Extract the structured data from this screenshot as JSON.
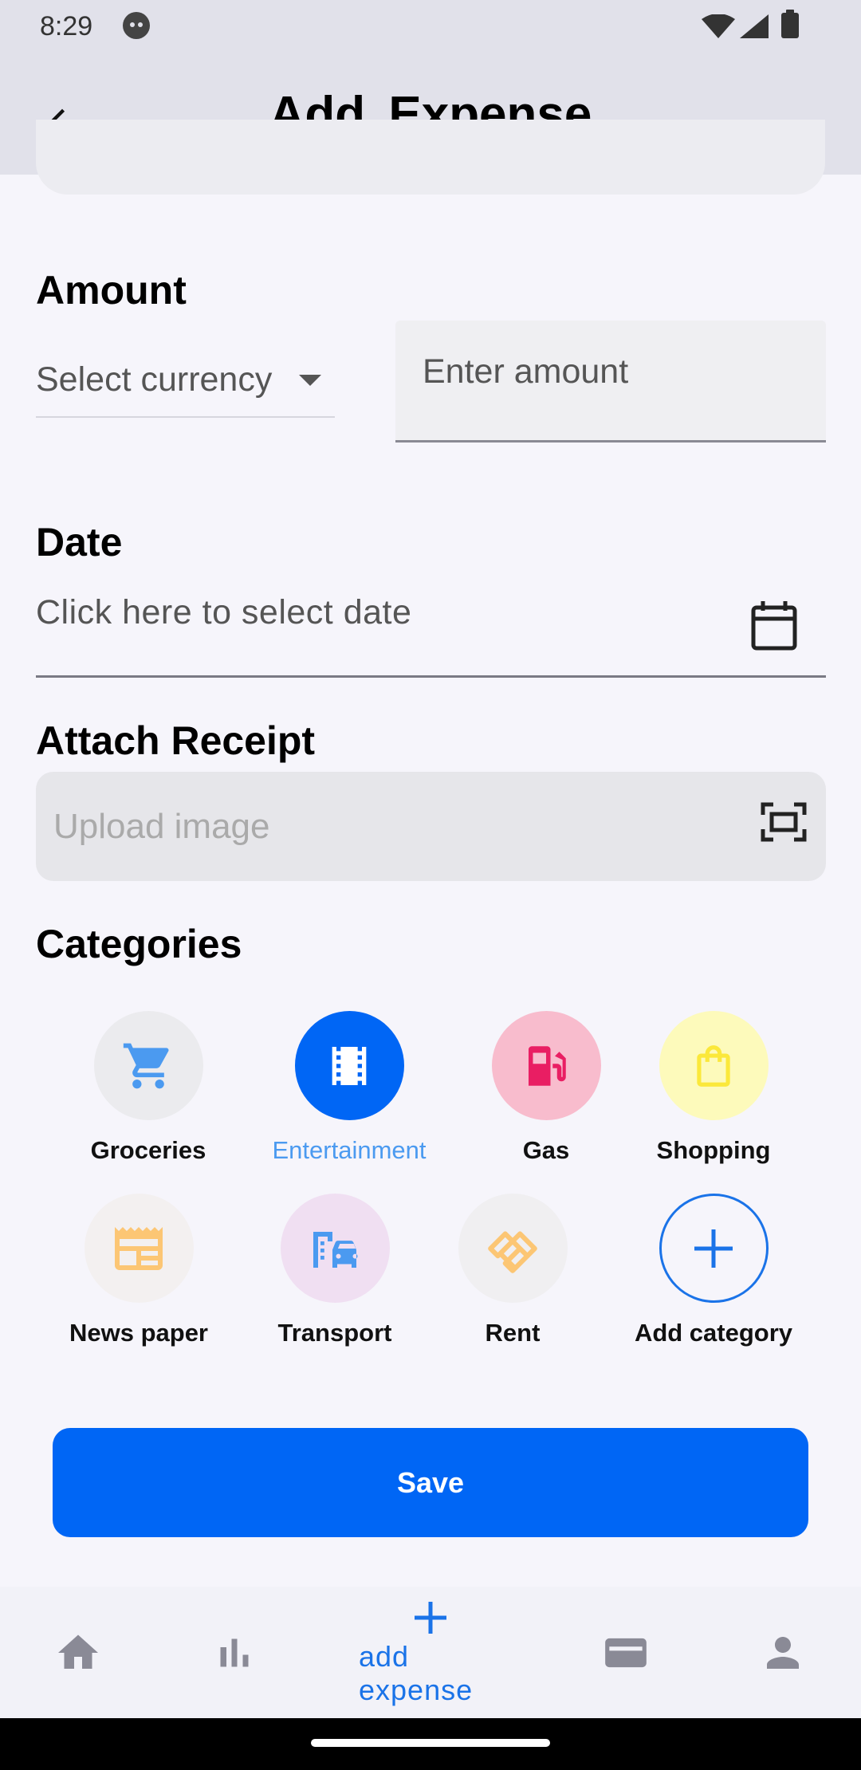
{
  "status_bar": {
    "time": "8:29"
  },
  "app_bar": {
    "title": "Add  Expense"
  },
  "amount": {
    "label": "Amount",
    "currency_placeholder": "Select currency",
    "amount_placeholder": "Enter amount"
  },
  "date": {
    "label": "Date",
    "placeholder": "Click here to select date"
  },
  "receipt": {
    "label": "Attach Receipt",
    "placeholder": "Upload image"
  },
  "categories": {
    "label": "Categories",
    "items": [
      {
        "label": "Groceries",
        "icon": "cart-icon",
        "bg": "#ebebee",
        "fg": "#4b9af0",
        "selected": false
      },
      {
        "label": "Entertainment",
        "icon": "film-icon",
        "bg": "#0066f5",
        "fg": "#ffffff",
        "selected": true
      },
      {
        "label": "Gas",
        "icon": "gas-pump-icon",
        "bg": "#f8bccd",
        "fg": "#e91e63",
        "selected": false
      },
      {
        "label": "Shopping",
        "icon": "shopping-bag-icon",
        "bg": "#fdfabb",
        "fg": "#fbe83a",
        "selected": false
      },
      {
        "label": "News paper",
        "icon": "newspaper-icon",
        "bg": "#f3f0f0",
        "fg": "#fcc674",
        "selected": false
      },
      {
        "label": "Transport",
        "icon": "transport-icon",
        "bg": "#f0dff2",
        "fg": "#4b9af0",
        "selected": false
      },
      {
        "label": "Rent",
        "icon": "handshake-icon",
        "bg": "#f0eff1",
        "fg": "#fcc674",
        "selected": false
      },
      {
        "label": "Add category",
        "icon": "plus-icon",
        "bg": "transparent",
        "fg": "#1a73e8",
        "selected": false
      }
    ]
  },
  "actions": {
    "save_label": "Save"
  },
  "bottom_nav": {
    "items": [
      {
        "icon": "home-icon"
      },
      {
        "icon": "bar-chart-icon"
      },
      {
        "icon": "plus-icon",
        "label": "add expense",
        "active": true
      },
      {
        "icon": "wallet-icon"
      },
      {
        "icon": "person-icon"
      }
    ]
  },
  "colors": {
    "primary": "#0066f5",
    "accent": "#1a73e8",
    "app_bar": "#e1e1ea",
    "background": "#f6f5fb"
  }
}
